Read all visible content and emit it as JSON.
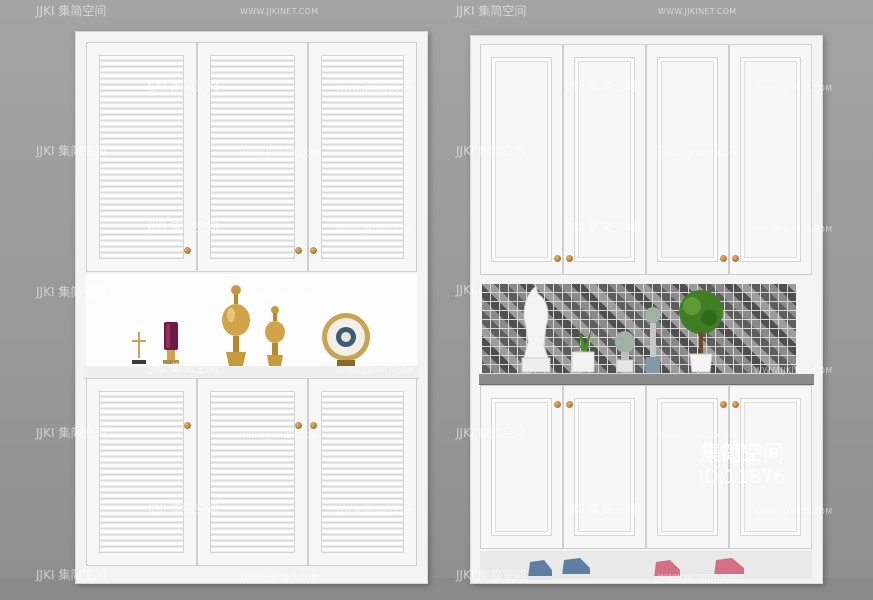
{
  "image": {
    "subject": "two white shoe cabinets",
    "colors": {
      "background": "#9a9a9a",
      "cabinet": "#f4f4f4",
      "handle": "#b07a30"
    }
  },
  "watermarks": {
    "logo": "JJKI",
    "chinese": "集简空间",
    "url": "WWW.JJKINET.COM"
  },
  "brand_stamp": {
    "name": "集简空间",
    "id_text": "ID:11876"
  }
}
